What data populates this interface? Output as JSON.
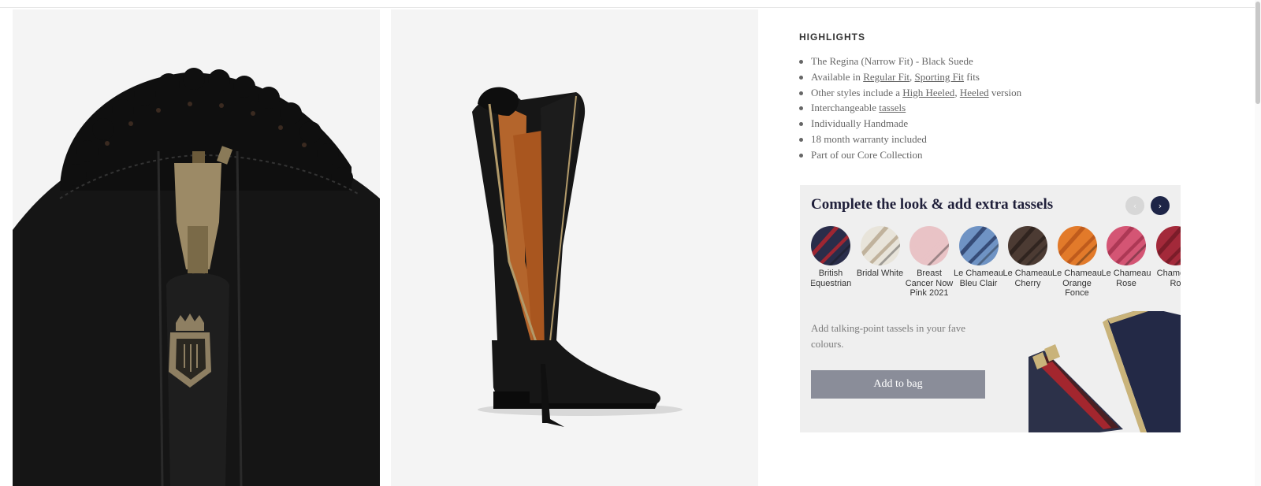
{
  "highlights": {
    "heading": "HIGHLIGHTS",
    "item1": "The Regina (Narrow Fit) - Black Suede",
    "item2_prefix": "Available in ",
    "item2_link1": "Regular Fit",
    "item2_sep": ", ",
    "item2_link2": "Sporting Fit",
    "item2_suffix": " fits",
    "item3_prefix": "Other styles include a ",
    "item3_link1": "High Heeled",
    "item3_sep": ", ",
    "item3_link2": "Heeled",
    "item3_suffix": " version",
    "item4_prefix": "Interchangeable ",
    "item4_link": "tassels",
    "item5": "Individually Handmade",
    "item6": "18 month warranty included",
    "item7": "Part of our Core Collection"
  },
  "upsell": {
    "title": "Complete the look & add extra tassels",
    "prev_glyph": "‹",
    "next_glyph": "›",
    "swatches": [
      {
        "label": "British Equestrian",
        "colors": [
          "#2a2d4a",
          "#b3262e"
        ]
      },
      {
        "label": "Bridal White",
        "colors": [
          "#e8e4da",
          "#b8a990"
        ]
      },
      {
        "label": "Breast Cancer Now Pink 2021",
        "colors": [
          "#e9c3c6",
          "#e9c3c6"
        ]
      },
      {
        "label": "Le Chameau Bleu Clair",
        "colors": [
          "#6f93c4",
          "#2d3f6b"
        ]
      },
      {
        "label": "Le Chameau Cherry",
        "colors": [
          "#4c3b33",
          "#2b211c"
        ]
      },
      {
        "label": "Le Chameau Orange Fonce",
        "colors": [
          "#e27a2a",
          "#b9561a"
        ]
      },
      {
        "label": "Le Chameau Rose",
        "colors": [
          "#d45574",
          "#a63450"
        ]
      },
      {
        "label": "Chameau Ro",
        "colors": [
          "#a3293a",
          "#741a27"
        ]
      }
    ],
    "description": "Add talking-point tassels in your fave colours.",
    "add_button": "Add to bag"
  },
  "images": {
    "left_alt": "Black suede boot zip detail",
    "mid_alt": "The Regina black suede boot"
  }
}
